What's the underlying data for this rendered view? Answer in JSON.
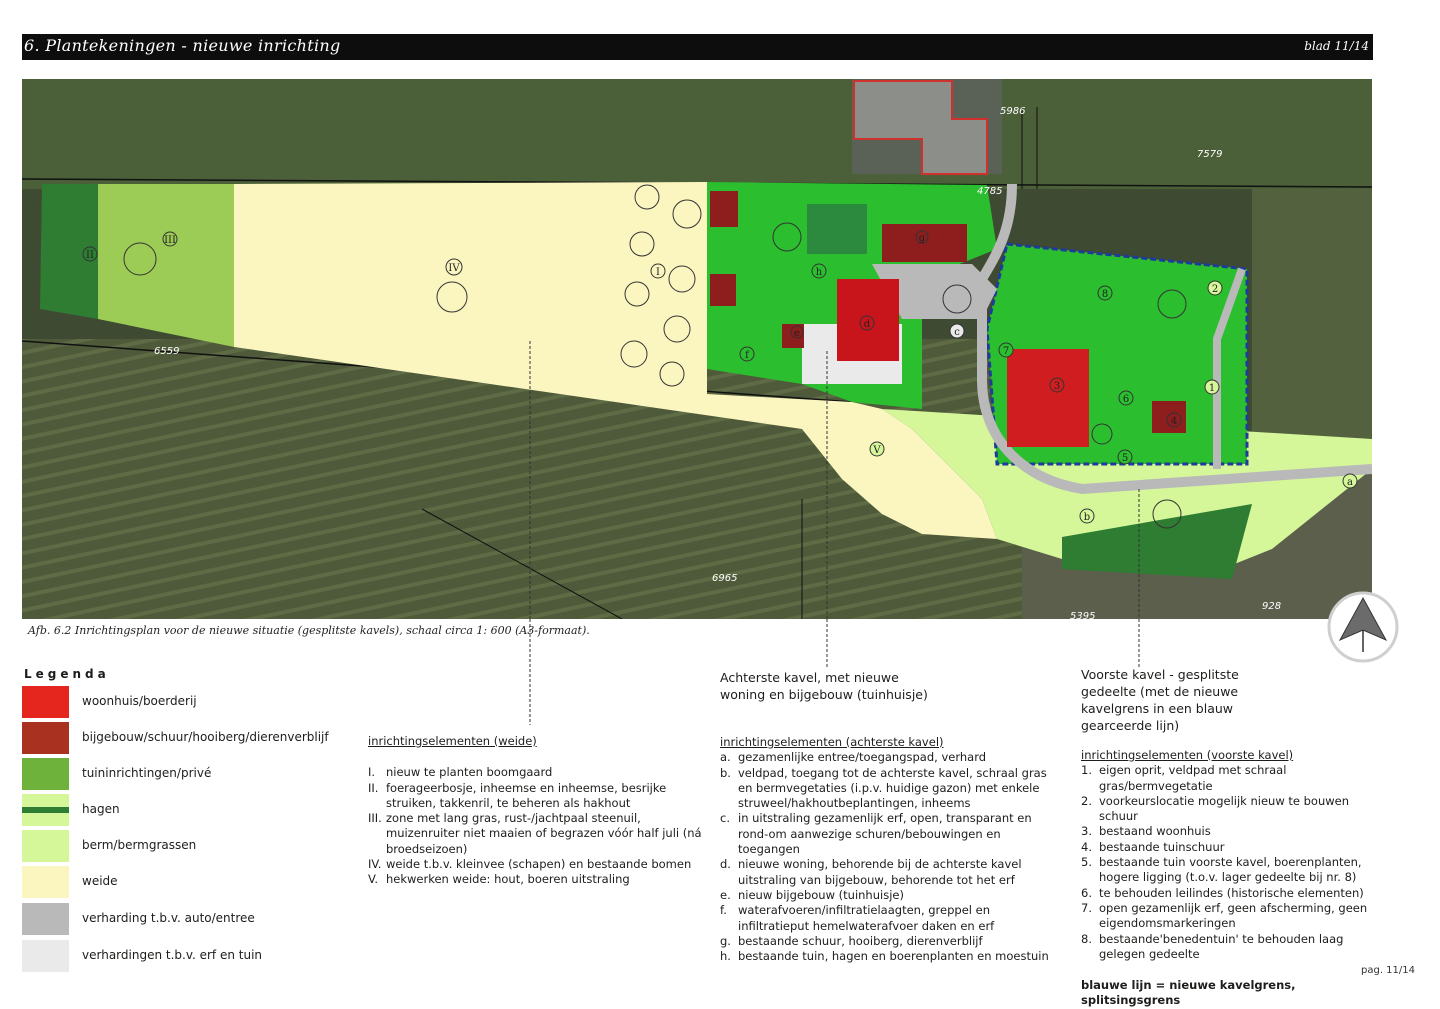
{
  "header": {
    "title": "6. Plantekeningen - nieuwe inrichting",
    "page": "blad 11/14"
  },
  "map": {
    "parcel_labels": [
      "5986",
      "7579",
      "4785",
      "6559",
      "6965",
      "5395",
      "928"
    ],
    "weide_markers": [
      "I",
      "II",
      "III",
      "IV",
      "V"
    ],
    "achter_markers": [
      "a",
      "b",
      "c",
      "d",
      "e",
      "f",
      "g",
      "h"
    ],
    "voor_markers": [
      "1",
      "2",
      "3",
      "4",
      "5",
      "6",
      "7",
      "8"
    ]
  },
  "caption": "Afb. 6.2 Inrichtingsplan voor de nieuwe situatie (gesplitste kavels), schaal circa 1: 600 (A3-formaat).",
  "legend": {
    "title": "Legenda",
    "items": [
      {
        "label": "woonhuis/boerderij",
        "color": "#e4261f"
      },
      {
        "label": "bijgebouw/schuur/hooiberg/dierenverblijf",
        "color": "#a8321f"
      },
      {
        "label": "tuininrichtingen/privé",
        "color": "#6eb23c"
      },
      {
        "label": "hagen",
        "color": "#2e7d32"
      },
      {
        "label": "berm/bermgrassen",
        "color": "#d5f79a"
      },
      {
        "label": "weide",
        "color": "#fbf6c0"
      },
      {
        "label": "verharding t.b.v. auto/entree",
        "color": "#b9b9b9"
      },
      {
        "label": "verhardingen t.b.v. erf en tuin",
        "color": "#eaeaea"
      }
    ]
  },
  "weide": {
    "heading": "inrichtingselementen (weide)",
    "items": [
      {
        "num": "I.",
        "text": "nieuw te planten boomgaard"
      },
      {
        "num": "II.",
        "text": "foerageerbosje, inheemse en inheemse, besrijke struiken, takkenril, te beheren als hakhout"
      },
      {
        "num": "III.",
        "text": "zone met lang gras, rust-/jachtpaal steenuil, muizenruiter niet maaien of begrazen vóór half juli (ná broedseizoen)"
      },
      {
        "num": "IV.",
        "text": "weide t.b.v. kleinvee (schapen) en bestaande bomen"
      },
      {
        "num": "V.",
        "text": "hekwerken weide: hout, boeren uitstraling"
      }
    ]
  },
  "achter": {
    "intro": "Achterste kavel, met nieuwe woning en bijgebouw (tuinhuisje)",
    "heading": "inrichtingselementen (achterste kavel)",
    "items": [
      {
        "num": "a.",
        "text": "gezamenlijke entree/toegangspad, verhard"
      },
      {
        "num": "b.",
        "text": "veldpad, toegang tot de achterste kavel, schraal gras en bermvegetaties (i.p.v. huidige gazon) met enkele struweel/hakhoutbeplantingen, inheems"
      },
      {
        "num": "c.",
        "text": "in uitstraling gezamenlijk erf, open, transparant en rond-om aanwezige schuren/bebouwingen en toegangen"
      },
      {
        "num": "d.",
        "text": "nieuwe woning, behorende bij de achterste kavel uitstraling van bijgebouw, behorende tot het erf"
      },
      {
        "num": "e.",
        "text": "nieuw bijgebouw (tuinhuisje)"
      },
      {
        "num": "f.",
        "text": "waterafvoeren/infiltratielaagten, greppel en infiltratieput hemelwaterafvoer daken en erf"
      },
      {
        "num": "g.",
        "text": "bestaande schuur, hooiberg, dierenverblijf"
      },
      {
        "num": "h.",
        "text": "bestaande tuin, hagen en boerenplanten en moestuin"
      }
    ]
  },
  "voor": {
    "intro": "Voorste kavel - gesplitste gedeelte (met de nieuwe kavelgrens in een blauw gearceerde lijn)",
    "heading": "inrichtingselementen (voorste kavel)",
    "items": [
      {
        "num": "1.",
        "text": "eigen oprit, veldpad met schraal gras/bermvegetatie"
      },
      {
        "num": "2.",
        "text": "voorkeurslocatie mogelijk nieuw te bouwen schuur"
      },
      {
        "num": "3.",
        "text": "bestaand woonhuis"
      },
      {
        "num": "4.",
        "text": "bestaande tuinschuur"
      },
      {
        "num": "5.",
        "text": "bestaande tuin voorste kavel, boerenplanten, hogere ligging (t.o.v. lager gedeelte bij nr. 8)"
      },
      {
        "num": "6.",
        "text": "te behouden leilindes (historische elementen)"
      },
      {
        "num": "7.",
        "text": "open gezamenlijk  erf, geen afscherming, geen eigendomsmarkeringen"
      },
      {
        "num": "8.",
        "text": "bestaande'benedentuin' te behouden laag gelegen gedeelte"
      }
    ],
    "note": "blauwe lijn = nieuwe kavelgrens, splitsingsgrens"
  },
  "footer": "pag. 11/14"
}
